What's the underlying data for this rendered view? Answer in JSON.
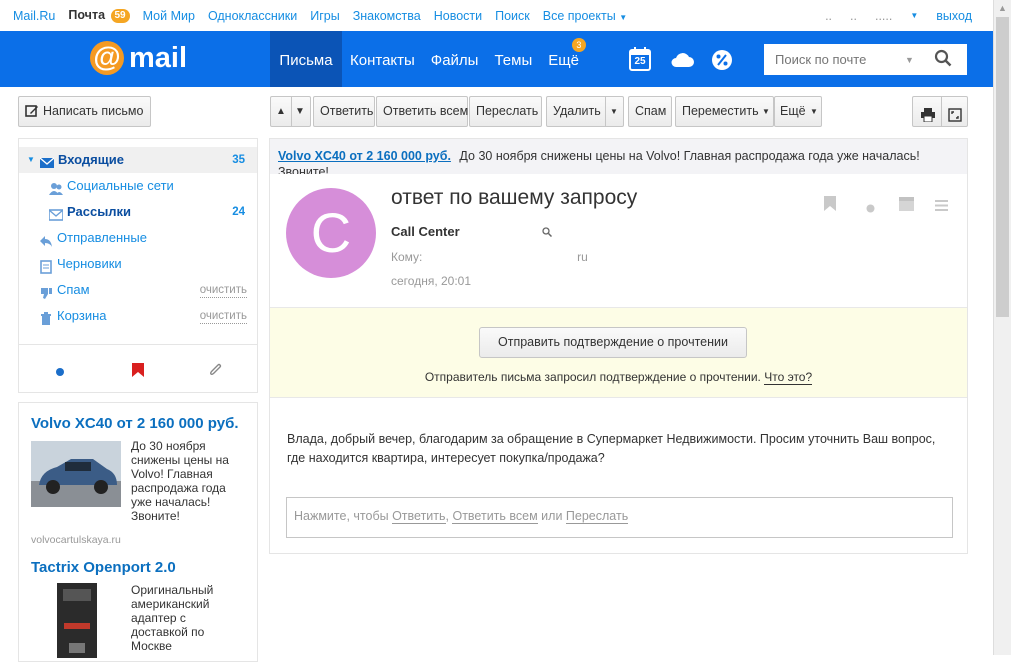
{
  "portal": {
    "items": [
      {
        "label": "Mail.Ru"
      },
      {
        "label": "Почта",
        "badge": "59"
      },
      {
        "label": "Мой Мир"
      },
      {
        "label": "Одноклассники"
      },
      {
        "label": "Игры"
      },
      {
        "label": "Знакомства"
      },
      {
        "label": "Новости"
      },
      {
        "label": "Поиск"
      },
      {
        "label": "Все проекты"
      }
    ],
    "logout": "выход"
  },
  "header": {
    "logo_text": "mail",
    "tabs": [
      {
        "label": "Письма",
        "active": true
      },
      {
        "label": "Контакты"
      },
      {
        "label": "Файлы"
      },
      {
        "label": "Темы"
      },
      {
        "label": "Ещё",
        "badge": "3"
      }
    ],
    "calendar_day": "25",
    "search_placeholder": "Поиск по почте"
  },
  "left": {
    "compose_label": "Написать письмо",
    "folders": [
      {
        "name": "Входящие",
        "count": "35",
        "active": true,
        "icon": "inbox-icon"
      },
      {
        "name": "Социальные сети",
        "count": "",
        "sub": true,
        "icon": "people-icon"
      },
      {
        "name": "Рассылки",
        "count": "24",
        "sub": true,
        "bold": true,
        "icon": "newsletter-icon"
      },
      {
        "name": "Отправленные",
        "icon": "sent-icon"
      },
      {
        "name": "Черновики",
        "icon": "drafts-icon"
      },
      {
        "name": "Спам",
        "clean": "очистить",
        "icon": "spam-icon"
      },
      {
        "name": "Корзина",
        "clean": "очистить",
        "icon": "trash-icon"
      }
    ]
  },
  "ads": [
    {
      "title": "Volvo XC40 от 2 160 000 руб.",
      "text": "До 30 ноября снижены цены на Volvo! Главная распродажа года уже началась! Звоните!",
      "domain": "volvocartulskaya.ru"
    },
    {
      "title": "Tactrix Openport 2.0",
      "text": "Оригинальный американский адаптер с доставкой по Москве"
    }
  ],
  "toolbar": {
    "reply": "Ответить",
    "reply_all": "Ответить всем",
    "forward": "Переслать",
    "delete": "Удалить",
    "spam": "Спам",
    "move": "Переместить",
    "more": "Ещё"
  },
  "message": {
    "promo_link": "Volvo XC40 от 2 160 000 руб.",
    "promo_text": "До 30 ноября снижены цены на Volvo! Главная распродажа года уже началась! Звоните!",
    "avatar_letter": "C",
    "subject": "ответ по вашему запросу",
    "sender": "Call Center",
    "to_label": "Кому:",
    "to_tail": "ru",
    "date": "сегодня, 20:01",
    "receipt_button": "Отправить подтверждение о прочтении",
    "receipt_note": "Отправитель письма запросил подтверждение о прочтении.",
    "receipt_link": "Что это?",
    "body": "Влада, добрый вечер, благодарим за обращение в Супермаркет Недвижимости. Просим уточнить Ваш вопрос, где находится квартира, интересует покупка/продажа?",
    "reply_prefix": "Нажмите, чтобы",
    "reply_link1": "Ответить",
    "reply_sep": ",",
    "reply_link2": "Ответить всем",
    "reply_or": "или",
    "reply_link3": "Переслать"
  },
  "colors": {
    "brand_blue": "#0b6fe8",
    "accent_orange": "#f5a623",
    "avatar": "#d68ed9"
  }
}
